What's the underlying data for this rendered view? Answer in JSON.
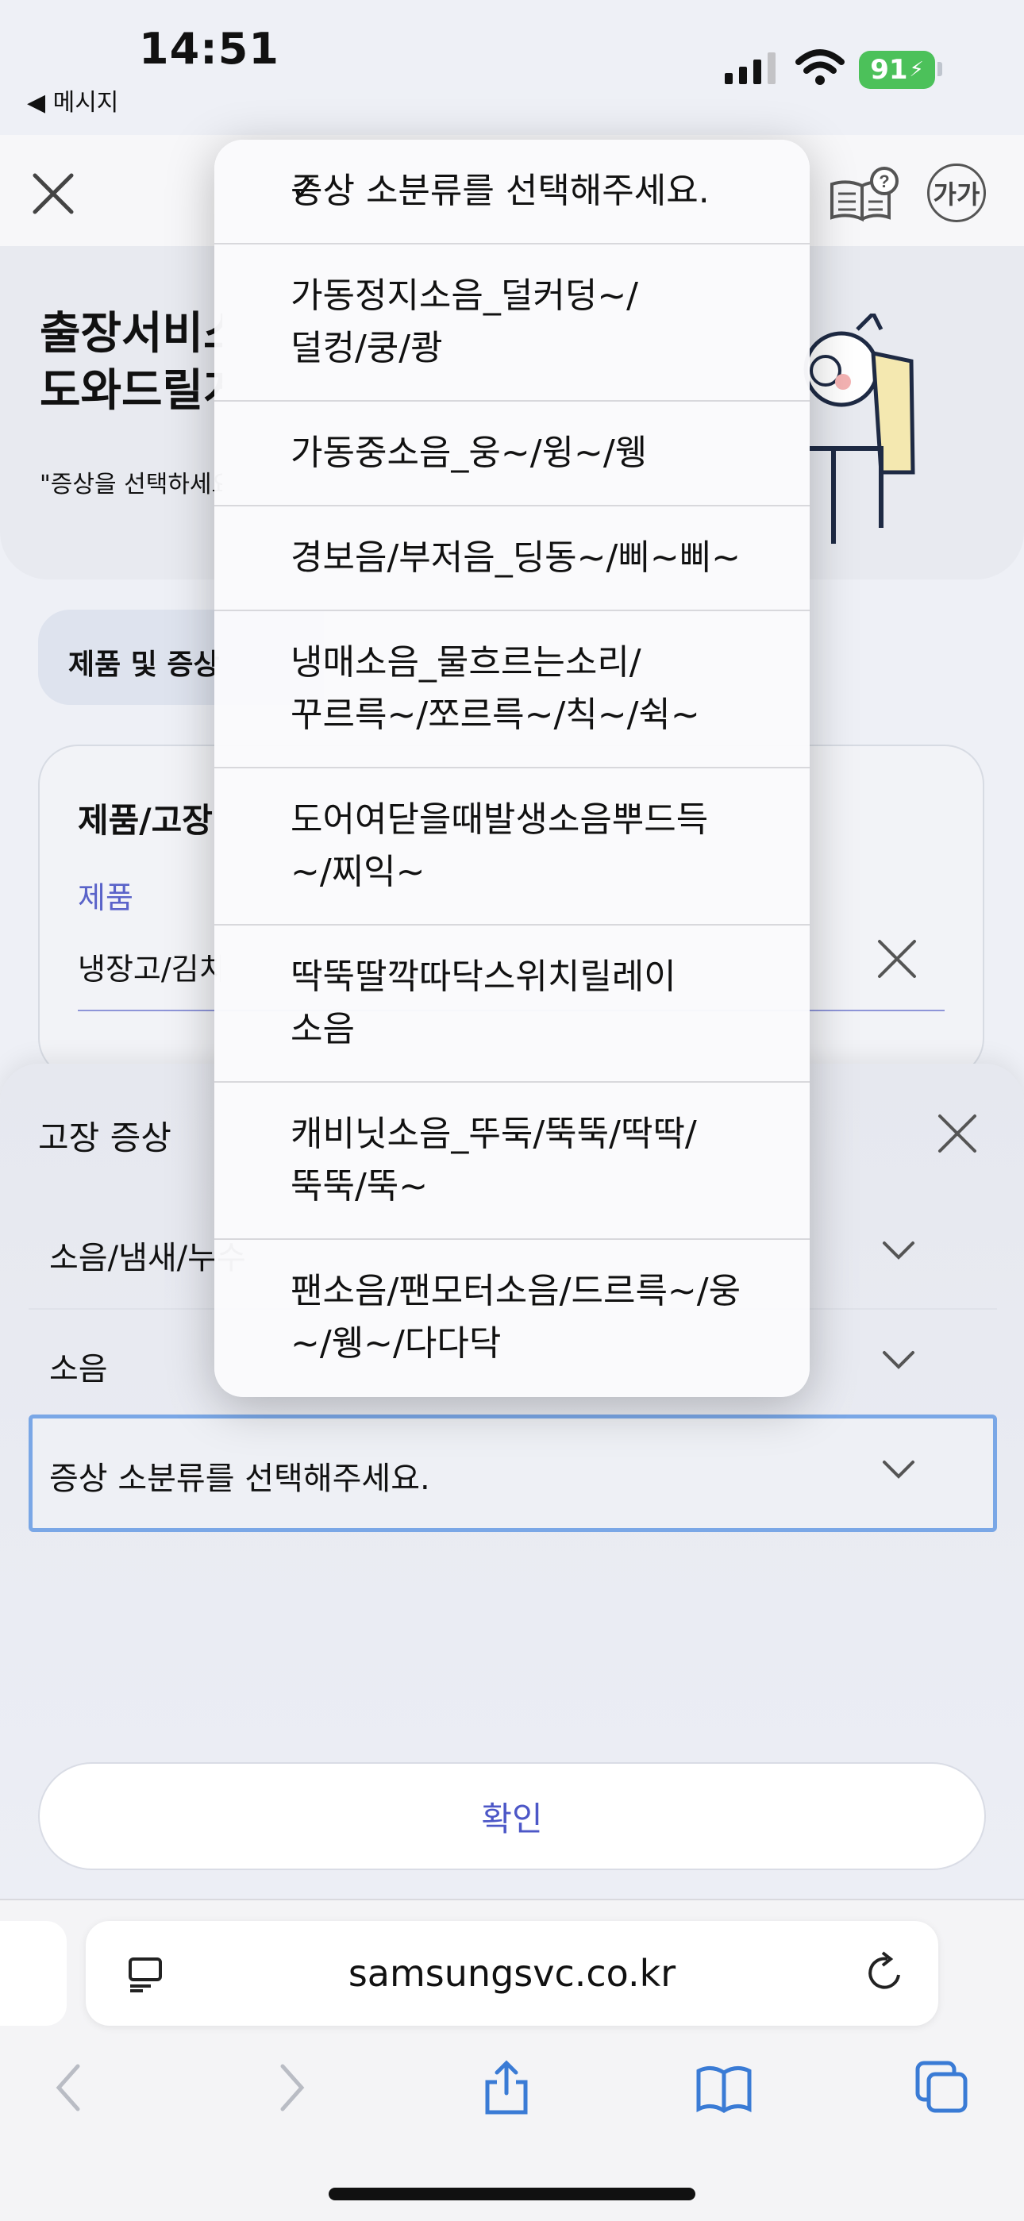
{
  "status": {
    "time": "14:51",
    "back_label": "◀ 메시지",
    "battery": "91"
  },
  "header": {
    "font_icon_label": "가가"
  },
  "hero": {
    "title": "출장서비스 도와드릴게요",
    "subtitle": "\"증상을 선택하세요\""
  },
  "tab_chip": {
    "label": "제품 및 증상"
  },
  "card": {
    "title": "제품/고장",
    "field_label": "제품",
    "field_value": "냉장고/김치냉장고"
  },
  "sheet": {
    "title": "고장 증상",
    "rows": [
      {
        "value": "소음/냄새/누수"
      },
      {
        "value": "소음"
      },
      {
        "value": "증상 소분류를 선택해주세요."
      }
    ],
    "confirm_label": "확인"
  },
  "safari": {
    "url": "samsungsvc.co.kr"
  },
  "dropdown": {
    "selected": "증상 소분류를 선택해주세요.",
    "options": [
      "가동정지소음_덜커덩~/\n덜컹/쿵/쾅",
      "가동중소음_웅~/윙~/웽",
      "경보음/부저음_딩동~/삐~삐~",
      "냉매소음_물흐르는소리/\n꾸르륵~/쪼르륵~/칙~/쉭~",
      "도어여닫을때발생소음뿌드득\n~/찌익~",
      "딱뚝딸깍따닥스위치릴레이\n소음",
      "캐비닛소음_뚜둑/뚝뚝/딱딱/\n뚝뚝/뚝~",
      "팬소음/팬모터소음/드르륵~/웅\n~/웽~/다다닥"
    ]
  }
}
